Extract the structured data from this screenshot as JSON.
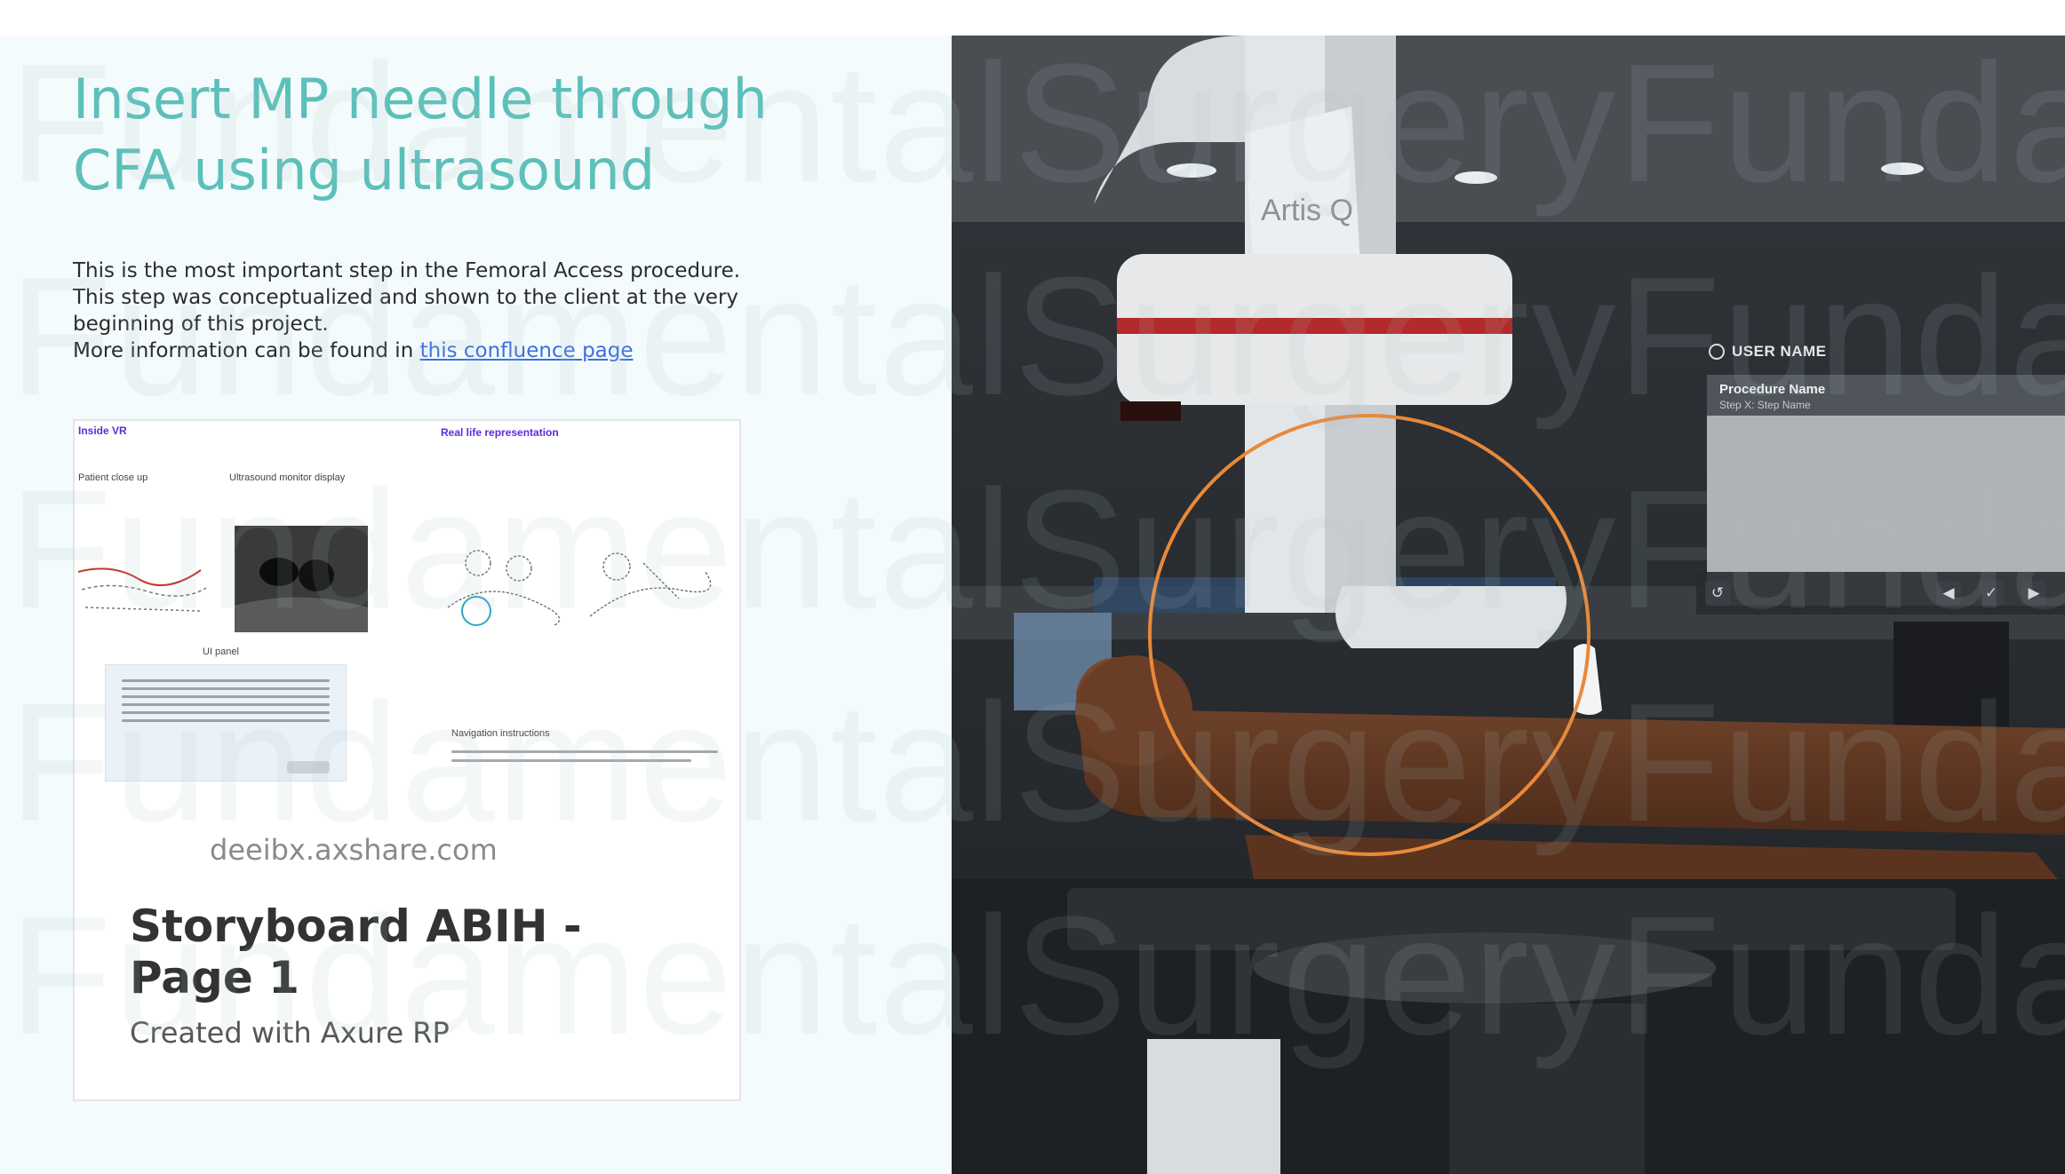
{
  "slide": {
    "title": "Insert MP needle through CFA using ultrasound",
    "description": {
      "line1": "This is the most important step in the Femoral Access procedure.",
      "line2": "This step was conceptualized and shown to the client at the very beginning of this project.",
      "line3_prefix": "More information can be found in ",
      "link_text": "this confluence page"
    },
    "watermark_text": "FundamentalSurgeryFundamentalSurgery"
  },
  "embed_card": {
    "thumbnail": {
      "inside_vr": "Inside VR",
      "real_life": "Real life representation",
      "patient_close_up": "Patient close up",
      "ultrasound_monitor": "Ultrasound monitor display",
      "ui_panel": "UI panel",
      "navigation": "Navigation instructions"
    },
    "domain": "deeibx.axshare.com",
    "title": "Storyboard ABIH - Page 1",
    "subtitle": "Created with Axure RP"
  },
  "scene": {
    "machine_label": "Artis Q",
    "hud": {
      "user_name": "USER NAME",
      "procedure_name": "Procedure Name",
      "step_name": "Step X: Step Name"
    },
    "colors": {
      "highlight_ring": "#e8893a",
      "title_teal": "#5cc0ba",
      "link_blue": "#3b6fe0"
    },
    "icons": [
      "user-icon",
      "reset-icon",
      "previous-icon",
      "confirm-icon",
      "next-icon"
    ]
  }
}
